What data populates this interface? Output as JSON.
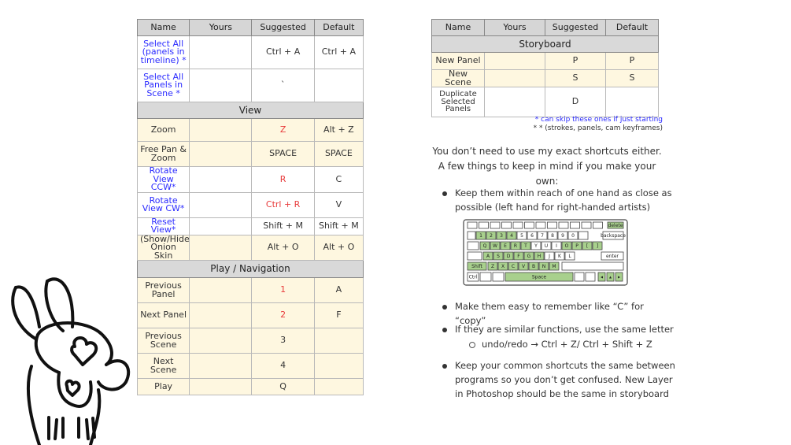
{
  "left_table": {
    "headers": [
      "Name",
      "Yours",
      "Suggested",
      "Default"
    ],
    "sections": {
      "view": "View",
      "play": "Play / Navigation"
    },
    "rows_top": [
      {
        "name": "Select All (panels in timeline) *",
        "suggested": "Ctrl + A",
        "default": "Ctrl + A"
      },
      {
        "name": "Select All Panels in Scene *",
        "suggested": "`",
        "default": ""
      }
    ],
    "rows_view": [
      {
        "name": "Zoom",
        "suggested": "Z",
        "default": "Alt + Z"
      },
      {
        "name": "Free Pan & Zoom",
        "suggested": "SPACE",
        "default": "SPACE"
      },
      {
        "name": "Rotate View CCW*",
        "suggested": "R",
        "default": "C"
      },
      {
        "name": "Rotate View CW*",
        "suggested": "Ctrl + R",
        "default": "V"
      },
      {
        "name": "Reset View*",
        "suggested": "Shift + M",
        "default": "Shift + M"
      },
      {
        "name": "(Show/Hide) Onion Skin",
        "suggested": "Alt + O",
        "default": "Alt + O"
      }
    ],
    "rows_play": [
      {
        "name": "Previous Panel",
        "suggested": "1",
        "default": "A"
      },
      {
        "name": "Next Panel",
        "suggested": "2",
        "default": "F"
      },
      {
        "name": "Previous Scene",
        "suggested": "3",
        "default": ""
      },
      {
        "name": "Next Scene",
        "suggested": "4",
        "default": ""
      },
      {
        "name": "Play",
        "suggested": "Q",
        "default": ""
      }
    ]
  },
  "right_table": {
    "headers": [
      "Name",
      "Yours",
      "Suggested",
      "Default"
    ],
    "section": "Storyboard",
    "rows": [
      {
        "name": "New Panel",
        "suggested": "P",
        "default": "P"
      },
      {
        "name": "New Scene",
        "suggested": "S",
        "default": "S"
      },
      {
        "name": "Duplicate Selected Panels",
        "suggested": "D",
        "default": ""
      }
    ]
  },
  "notes": {
    "line1": "* can skip these ones if just starting",
    "line2": "* * (strokes, panels, cam keyframes)"
  },
  "intro": "You don’t need to use my exact shortcuts either. A few things to keep in mind if you make your own:",
  "bullets": [
    "Keep them within reach of one hand as close as possible (left hand for right-handed artists)",
    "Make them easy to remember like “C” for “copy”",
    "If they are similar functions, use the same letter",
    "Keep your common shortcuts the same between programs so you don’t get confused. New Layer in Photoshop should be the same in storyboard"
  ],
  "sub_bullet": "undo/redo → Ctrl + Z/ Ctrl + Shift + Z",
  "keyboard": {
    "row1": [
      "1",
      "2",
      "3",
      "4",
      "5",
      "6",
      "7",
      "8",
      "9",
      "0"
    ],
    "row2": [
      "Q",
      "W",
      "E",
      "R",
      "T",
      "Y",
      "U",
      "I",
      "O",
      "P",
      "[",
      "]"
    ],
    "row3": [
      "A",
      "S",
      "D",
      "F",
      "G",
      "H",
      "J",
      "K",
      "L"
    ],
    "row4": [
      "Z",
      "X",
      "C",
      "V",
      "B",
      "N",
      "M"
    ],
    "delete": "delete",
    "backspace": "backspace",
    "enter": "enter",
    "shift": "Shift",
    "ctrl": "Ctrl",
    "space": "Space",
    "highlight": "#a8d08d"
  },
  "colors": {
    "header_bg": "#d6d6d6",
    "row_yellow": "#fef7e0",
    "blue_text": "#2b2bff",
    "red_text": "#e83a3a"
  }
}
